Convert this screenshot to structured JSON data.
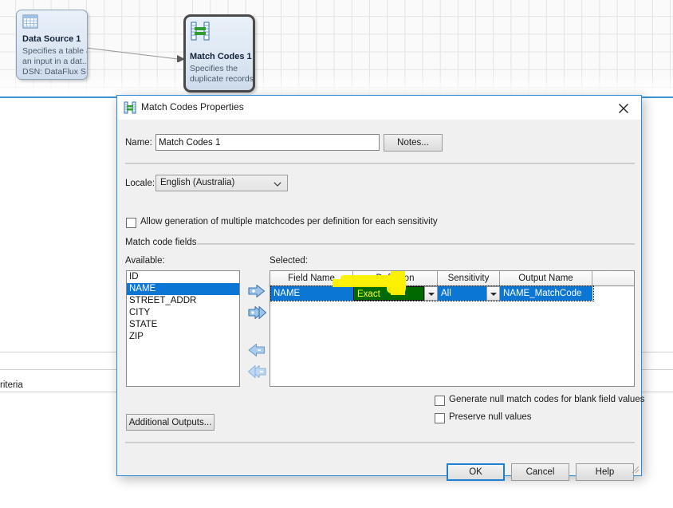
{
  "canvas": {
    "nodes": [
      {
        "id": "data-source-1",
        "title": "Data Source 1",
        "desc_lines": [
          "Specifies a table as",
          "an input in a dat...",
          "DSN: DataFlux S..."
        ],
        "icon": "table-grid-icon",
        "selected": false
      },
      {
        "id": "match-codes-1",
        "title": "Match Codes 1",
        "desc_lines": [
          "Specifies the",
          "duplicate records..."
        ],
        "icon": "match-codes-icon",
        "selected": true
      }
    ],
    "connector": "data-source-to-match-codes-arrow"
  },
  "background_panes": {
    "criteria_label": "riteria"
  },
  "dialog": {
    "title": "Match Codes Properties",
    "icon": "match-codes-icon",
    "close_icon": "close-icon",
    "name_label": "Name:",
    "name_value": "Match Codes 1",
    "name_placeholder": "",
    "notes_button": "Notes...",
    "locale_label": "Locale:",
    "locale_value": "English (Australia)",
    "locale_options": [
      "English (Australia)"
    ],
    "allow_multiple_checkbox": {
      "label": "Allow generation of multiple matchcodes per definition for each sensitivity",
      "checked": false
    },
    "group_title": "Match code fields",
    "available_label": "Available:",
    "available_items": [
      {
        "label": "ID",
        "selected": false
      },
      {
        "label": "NAME",
        "selected": true
      },
      {
        "label": "STREET_ADDR",
        "selected": false
      },
      {
        "label": "CITY",
        "selected": false
      },
      {
        "label": "STATE",
        "selected": false
      },
      {
        "label": "ZIP",
        "selected": false
      }
    ],
    "transfer_buttons": [
      {
        "name": "add-selected-button",
        "icon": "arrow-right-plus-icon"
      },
      {
        "name": "add-all-button",
        "icon": "double-arrow-right-plus-icon"
      },
      {
        "name": "remove-selected-button",
        "icon": "arrow-left-minus-icon"
      },
      {
        "name": "remove-all-button",
        "icon": "double-arrow-left-minus-icon"
      }
    ],
    "selected_label": "Selected:",
    "grid": {
      "columns": [
        "Field Name",
        "Definition",
        "Sensitivity",
        "Output Name"
      ],
      "rows": [
        {
          "field_name": "NAME",
          "definition": "Exact",
          "sensitivity": "All",
          "output_name": "NAME_MatchCode",
          "selected": true,
          "editing_cell": "definition"
        }
      ]
    },
    "generate_null_checkbox": {
      "label": "Generate null match codes for blank field values",
      "checked": false
    },
    "preserve_null_checkbox": {
      "label": "Preserve null values",
      "checked": false
    },
    "additional_outputs_button": "Additional Outputs...",
    "ok_button": "OK",
    "cancel_button": "Cancel",
    "help_button": "Help"
  },
  "colors": {
    "dialog_border": "#2c8cd6",
    "selection_blue": "#0b76d4",
    "edit_green": "#006a00",
    "edit_text_yellow": "#ffff22",
    "highlighter_yellow": "#fbf000",
    "canvas_grid": "#e3e3e3",
    "accent_line": "#3a93d0"
  }
}
